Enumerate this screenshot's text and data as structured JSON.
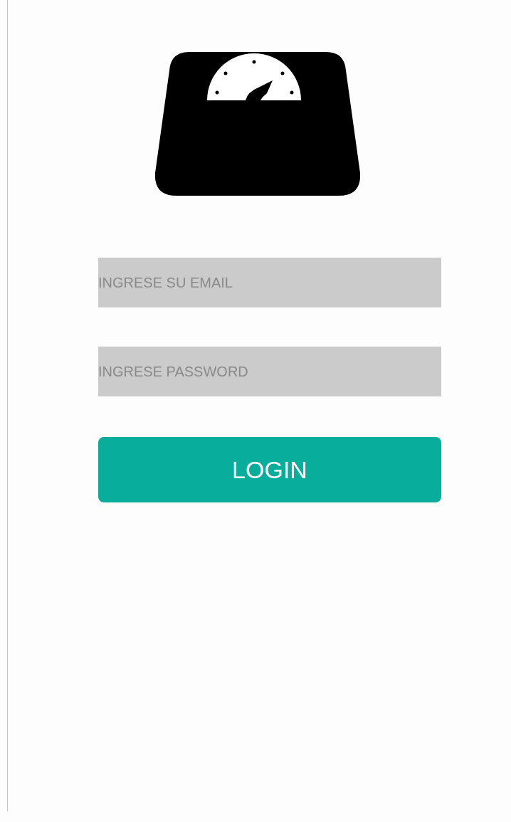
{
  "form": {
    "fields": [
      {
        "placeholder": "INGRESE SU EMAIL"
      },
      {
        "placeholder": "INGRESE PASSWORD"
      }
    ],
    "login_button": {
      "label": "LOGIN"
    }
  }
}
